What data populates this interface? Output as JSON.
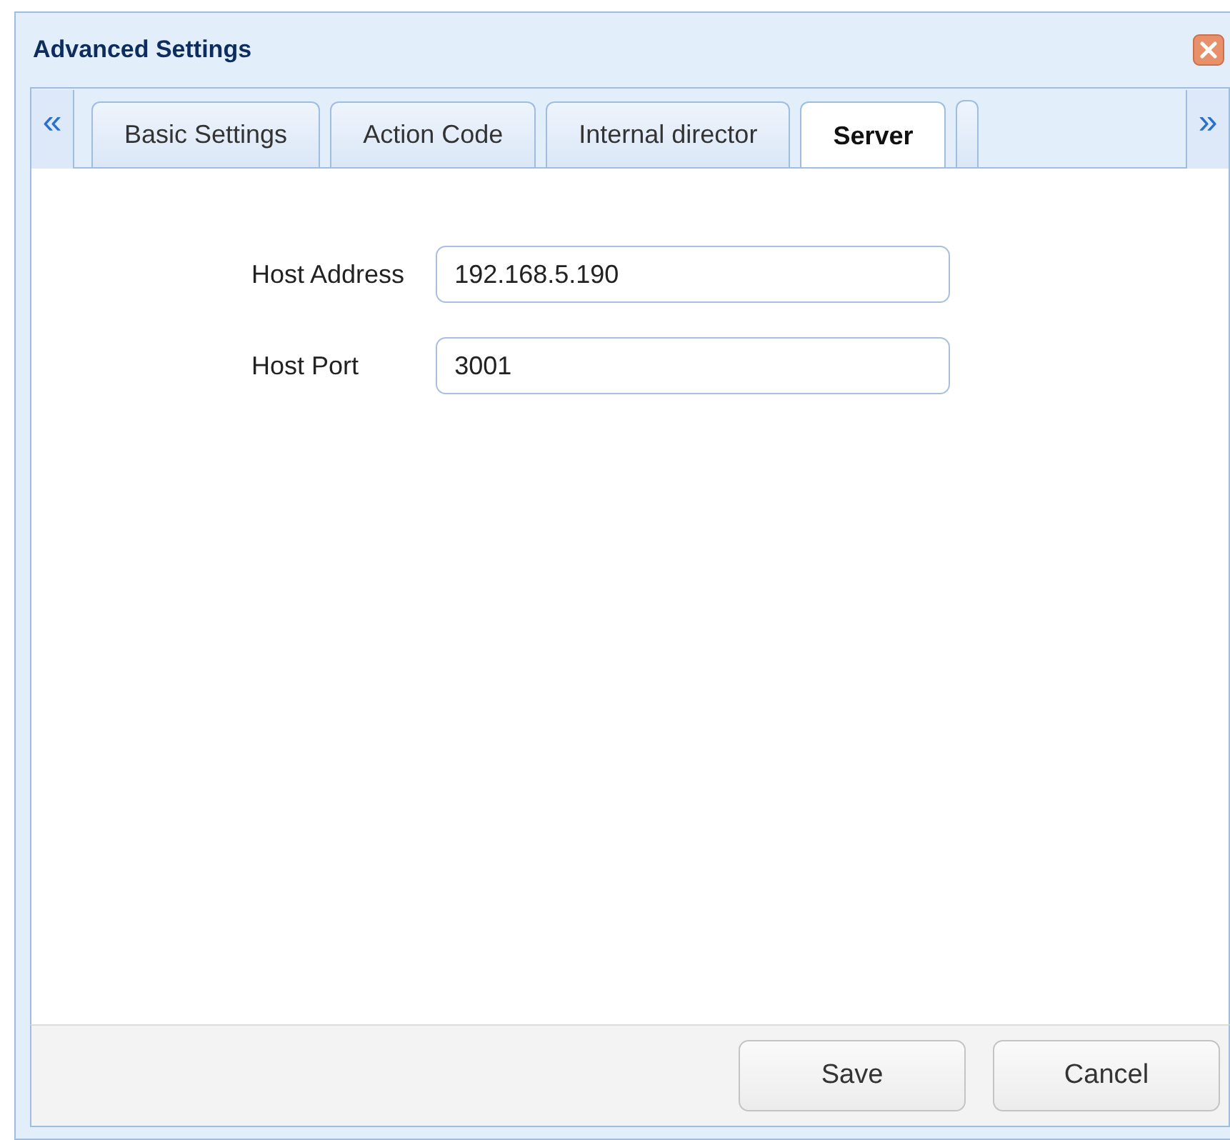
{
  "window": {
    "title": "Advanced Settings"
  },
  "tabs_scroll": {
    "left": "«",
    "right": "»"
  },
  "tabs": [
    {
      "label": "Basic Settings",
      "selected": false
    },
    {
      "label": "Action Code",
      "selected": false
    },
    {
      "label": "Internal director",
      "selected": false
    },
    {
      "label": "Server",
      "selected": true
    }
  ],
  "fields": [
    {
      "label": "Host Address",
      "value": "192.168.5.190"
    },
    {
      "label": "Host Port",
      "value": "3001"
    }
  ],
  "buttons": [
    "Save",
    "Cancel"
  ]
}
